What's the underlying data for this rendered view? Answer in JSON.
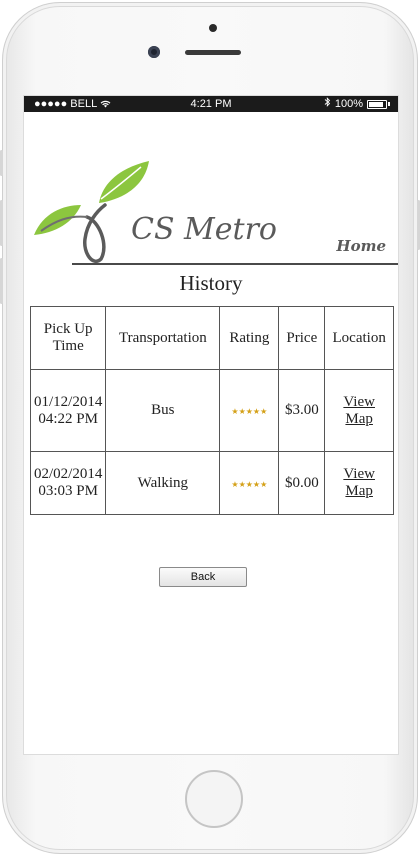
{
  "statusbar": {
    "carrier": "●●●●● BELL",
    "time": "4:21 PM",
    "battery": "100%"
  },
  "header": {
    "brand": "CS Metro",
    "home_link": "Home"
  },
  "page_title": "History",
  "table": {
    "headers": [
      "Pick Up Time",
      "Transportation",
      "Rating",
      "Price",
      "Location"
    ],
    "rows": [
      {
        "pickup": "01/12/2014 04:22 PM",
        "transport": "Bus",
        "rating": "★★★★★",
        "price": "$3.00",
        "location": "View Map"
      },
      {
        "pickup": "02/02/2014 03:03 PM",
        "transport": "Walking",
        "rating": "★★★★★",
        "price": "$0.00",
        "location": "View Map"
      }
    ]
  },
  "back_label": "Back",
  "colors": {
    "leaf_green": "#8cc63f",
    "star_gold": "#d4a017",
    "status_bg": "#1b1b1b"
  }
}
